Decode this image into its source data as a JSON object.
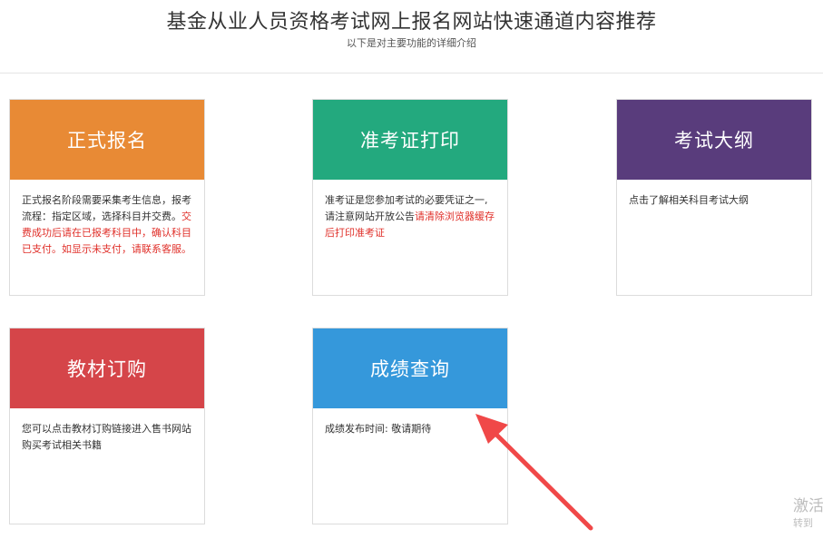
{
  "header": {
    "title": "基金从业人员资格考试网上报名网站快速通道内容推荐",
    "subtitle": "以下是对主要功能的详细介绍"
  },
  "cards": [
    {
      "title": "正式报名",
      "color": "#e88a35",
      "desc": "正式报名阶段需要采集考生信息，报考流程：指定区域，选择科目并交费。",
      "warn": "交费成功后请在已报考科目中，确认科目已支付。如显示未支付，请联系客服。"
    },
    {
      "title": "准考证打印",
      "color": "#23a97e",
      "desc": "准考证是您参加考试的必要凭证之一,请注意网站开放公告",
      "warn": "请清除浏览器缓存后打印准考证"
    },
    {
      "title": "考试大纲",
      "color": "#593c7c",
      "desc": "点击了解相关科目考试大纲",
      "warn": ""
    },
    {
      "title": "教材订购",
      "color": "#d54549",
      "desc": "您可以点击教材订购链接进入售书网站购买考试相关书籍",
      "warn": ""
    },
    {
      "title": "成绩查询",
      "color": "#3598db",
      "desc": "成绩发布时间: 敬请期待",
      "warn": ""
    }
  ],
  "watermark": {
    "line1": "激活",
    "line2": "转到"
  },
  "annotation": {
    "arrow_color": "#f04848"
  }
}
